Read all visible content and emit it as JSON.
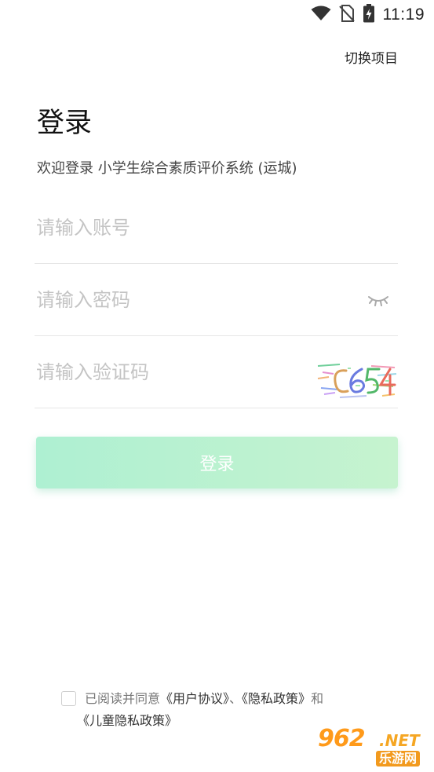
{
  "status_bar": {
    "time": "11:19",
    "icons": [
      "wifi-icon",
      "no-sim-icon",
      "battery-charging-icon"
    ]
  },
  "header": {
    "switch_project": "切换项目"
  },
  "main": {
    "title": "登录",
    "welcome": "欢迎登录 小学生综合素质评价系统 (运城)"
  },
  "form": {
    "account_placeholder": "请输入账号",
    "password_placeholder": "请输入密码",
    "captcha_placeholder": "请输入验证码",
    "captcha_code": "C654",
    "login_label": "登录"
  },
  "agreement": {
    "prefix": "已阅读并同意",
    "user_agreement": "《用户协议》",
    "separator": "、",
    "privacy_policy": "《隐私政策》",
    "and": "和",
    "children_privacy": "《儿童隐私政策》",
    "checked": false
  },
  "watermark": {
    "brand": "962",
    "suffix": ".NET",
    "site": "乐游网"
  },
  "colors": {
    "button_start": "#aef0d2",
    "button_end": "#c6f3cf",
    "placeholder": "#c4c4c4",
    "watermark": "#f29a1e"
  }
}
